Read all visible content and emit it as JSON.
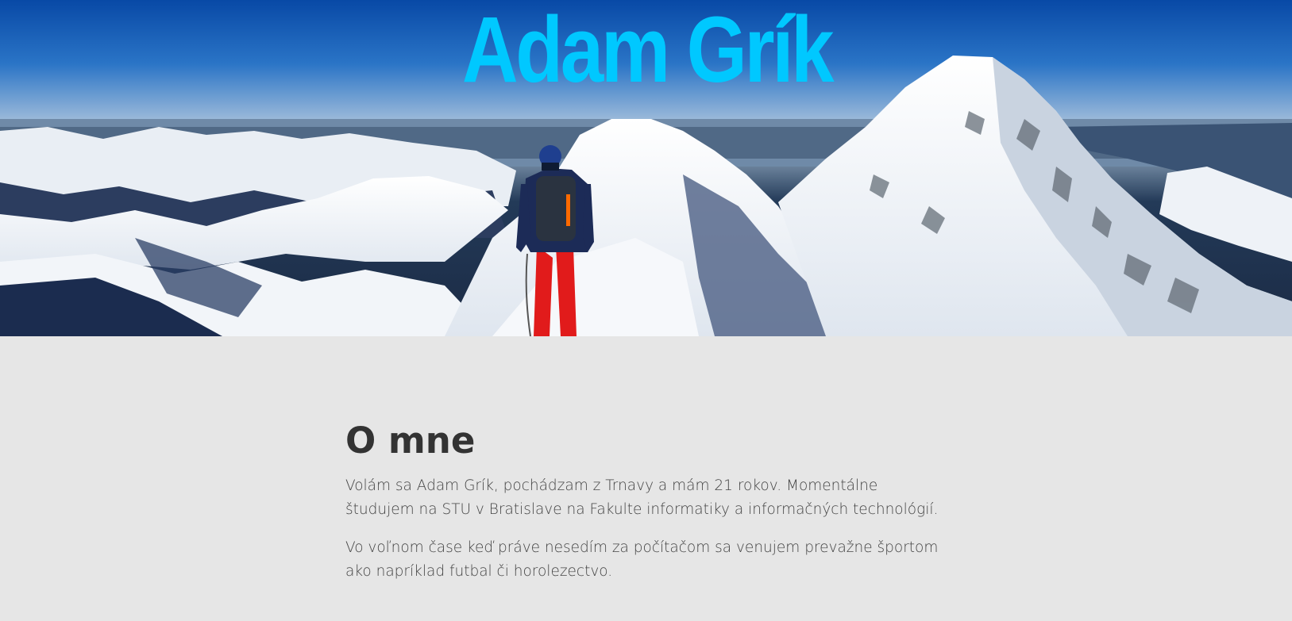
{
  "header": {
    "title": "Adam Grík",
    "title_color": "#00c8ff",
    "banner_icon": "mountain-climber-photo"
  },
  "about": {
    "heading": "O mne",
    "paragraphs": [
      "Volám sa Adam Grík, pochádzam z Trnavy a mám 21 rokov. Momentálne študujem na STU v Bratislave na Fakulte informatiky a informačných technológií.",
      "Vo voľnom čase keď práve nesedím za počítačom sa venujem prevažne športom ako napríklad futbal či horolezectvo."
    ]
  },
  "colors": {
    "page_background": "#e6e6e6",
    "text": "#444444",
    "heading": "#333333",
    "sky_top": "#0a4fa8"
  }
}
